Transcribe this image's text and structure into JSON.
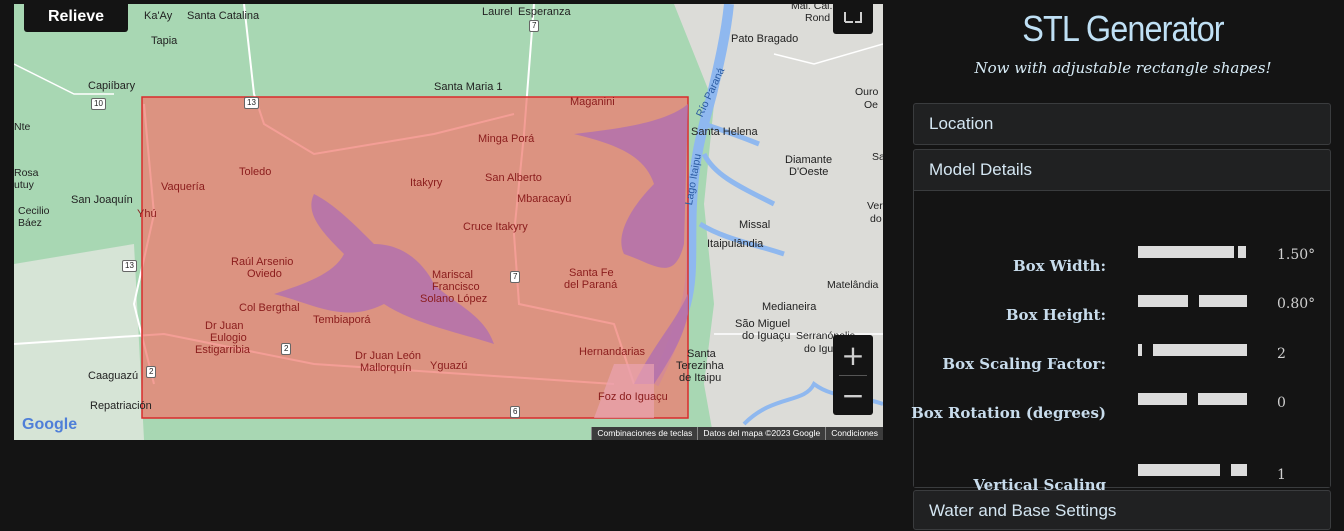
{
  "map": {
    "relieve_label": "Relieve",
    "zoom_in": "+",
    "zoom_out": "−",
    "google_logo": "Google",
    "attribution": [
      "Combinaciones de teclas",
      "Datos del mapa ©2023 Google",
      "Condiciones"
    ],
    "places": [
      "Ka'Ay",
      "Santa Catalina",
      "Laurel",
      "Esperanza",
      "Mal. Cal.",
      "Rond",
      "Pato Bragado",
      "Tapia",
      "Capiíbary",
      "Santa Maria 1",
      "Maganini",
      "Ouro",
      "Oe",
      "Nte",
      "Minga Porá",
      "Santa Helena",
      "Rosa",
      "utuy",
      "Vaquería",
      "Toledo",
      "Itakyry",
      "San Alberto",
      "Diamante",
      "D'Oeste",
      "Sa",
      "San Joaquín",
      "Mbaracayú",
      "Cecilio",
      "Báez",
      "Yhú",
      "Cruce Itakyry",
      "Missal",
      "Ver",
      "do",
      "Itaipulândia",
      "Raúl Arsenio",
      "Oviedo",
      "Mariscal",
      "Francisco",
      "Solano López",
      "Santa Fe",
      "del Paraná",
      "Matelândia",
      "Col Bergthal",
      "Tembiaporá",
      "Medianeira",
      "Dr Juan",
      "Eulogio",
      "Estigarribia",
      "São Miguel",
      "do Iguaçu",
      "Serranópolis",
      "do Iguç",
      "Dr Juan León",
      "Mallorquín",
      "Yguazú",
      "Hernandarias",
      "Santa",
      "Terezinha",
      "de Itaipu",
      "Caaguazú",
      "Repatriación",
      "Foz do Iguaçu"
    ],
    "road_shields": [
      "7",
      "10",
      "13",
      "13",
      "7",
      "2",
      "2",
      "6"
    ],
    "river_labels": [
      "Río Paraná",
      "Lago Itaipu"
    ]
  },
  "app": {
    "title": "STL Generator",
    "subtitle": "Now with adjustable rectangle shapes!"
  },
  "sections": {
    "location": "Location",
    "model_details": "Model Details",
    "water_base": "Water and Base Settings"
  },
  "model_details": {
    "rows": [
      {
        "label": "Box Width:",
        "value": "1.50°",
        "fraction": 0.9
      },
      {
        "label": "Box Height:",
        "value": "0.80°",
        "fraction": 0.5
      },
      {
        "label": "Box Scaling Factor:",
        "value": "2",
        "fraction": 0.1
      },
      {
        "label": "Box Rotation (degrees)",
        "value": "0",
        "fraction": 0.5
      },
      {
        "label": "Vertical Scaling",
        "value": "1",
        "fraction": 0.85
      }
    ]
  }
}
